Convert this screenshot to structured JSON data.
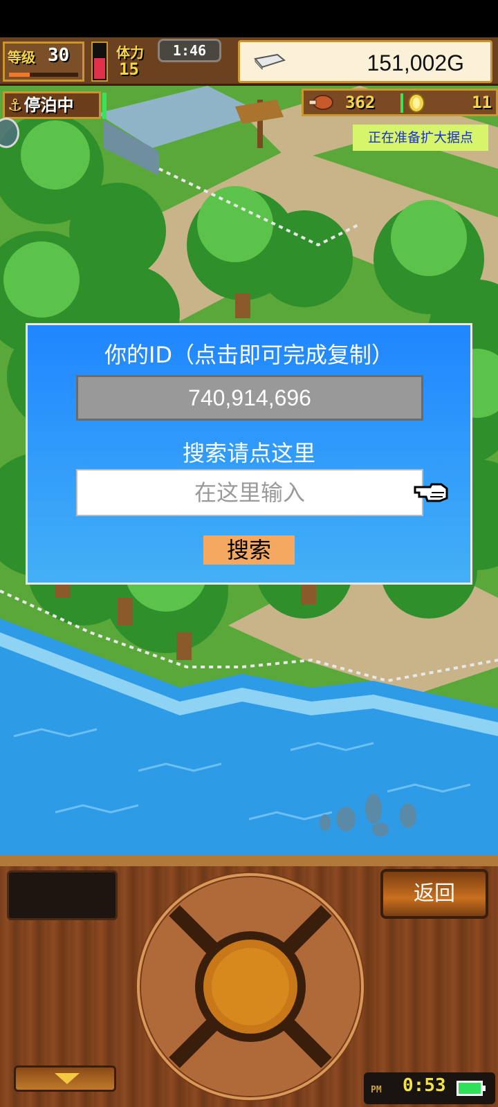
{
  "hud": {
    "level_label": "等级",
    "level_value": "30",
    "stamina_label": "体力",
    "stamina_value": "15",
    "timer": "1:46",
    "money": "151,002G",
    "xp_fraction": 0.3,
    "stamina_fraction": 0.55
  },
  "status_row": {
    "anchor_label": "停泊中",
    "food_value": "362",
    "medal_value": "11",
    "notice": "正在准备扩大据点"
  },
  "dialog": {
    "title": "你的ID（点击即可完成复制）",
    "user_id": "740,914,696",
    "search_prompt": "搜索请点这里",
    "search_placeholder": "在这里输入",
    "search_button": "搜索"
  },
  "panel": {
    "back_button": "返回",
    "clock_ampm": "PM",
    "clock_time": "0:53"
  },
  "colors": {
    "dialog_top": "#1f86ff",
    "dialog_bottom": "#43b0f6",
    "search_button": "#f4a860",
    "notice_bg": "#d6f56a",
    "notice_text": "#1a2fcc",
    "hud_gold": "#f4d64b"
  },
  "icons": [
    "anchor-icon",
    "ingot-icon",
    "meat-icon",
    "medal-icon",
    "pointing-hand-icon",
    "down-arrow-icon",
    "battery-icon"
  ]
}
